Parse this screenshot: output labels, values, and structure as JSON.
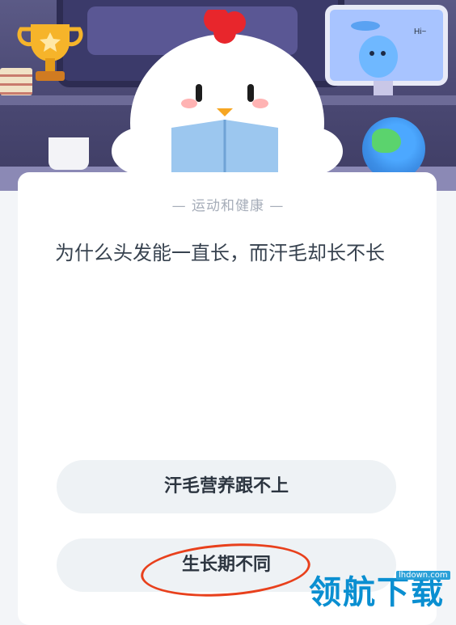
{
  "card": {
    "category": "— 运动和健康 —",
    "question": "为什么头发能一直长，而汗毛却长不长"
  },
  "options": [
    {
      "label": "汗毛营养跟不上"
    },
    {
      "label": "生长期不同",
      "hand_circled": true
    }
  ],
  "watermark": {
    "small": "lhdown.com",
    "big": "领航下载"
  },
  "hero": {
    "monitor_text": "Hi~"
  },
  "colors": {
    "accent_circle": "#e8401c",
    "watermark_blue": "#0a8fd1",
    "option_bg": "#eef2f5"
  }
}
